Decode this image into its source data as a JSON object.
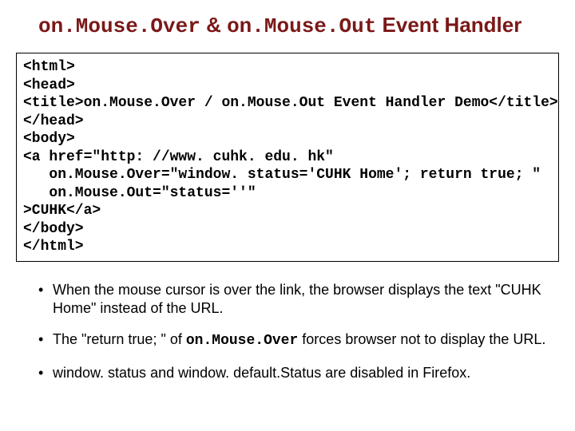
{
  "title": {
    "part1": "on.Mouse.Over",
    "sep": " & ",
    "part2": "on.Mouse.Out",
    "tail": " Event Handler"
  },
  "code": "<html>\n<head>\n<title>on.Mouse.Over / on.Mouse.Out Event Handler Demo</title>\n</head>\n<body>\n<a href=\"http: //www. cuhk. edu. hk\"\n   on.Mouse.Over=\"window. status='CUHK Home'; return true; \"\n   on.Mouse.Out=\"status=''\"\n>CUHK</a>\n</body>\n</html>",
  "bullets": [
    {
      "pre": "When the mouse cursor is over the link, the browser displays the text \"CUHK Home\" instead of the URL."
    },
    {
      "pre": "The \"return true; \" of ",
      "mono": "on.Mouse.Over",
      "post": " forces browser not to display the URL."
    },
    {
      "pre": "window. status and window. default.Status are disabled in Firefox."
    }
  ]
}
